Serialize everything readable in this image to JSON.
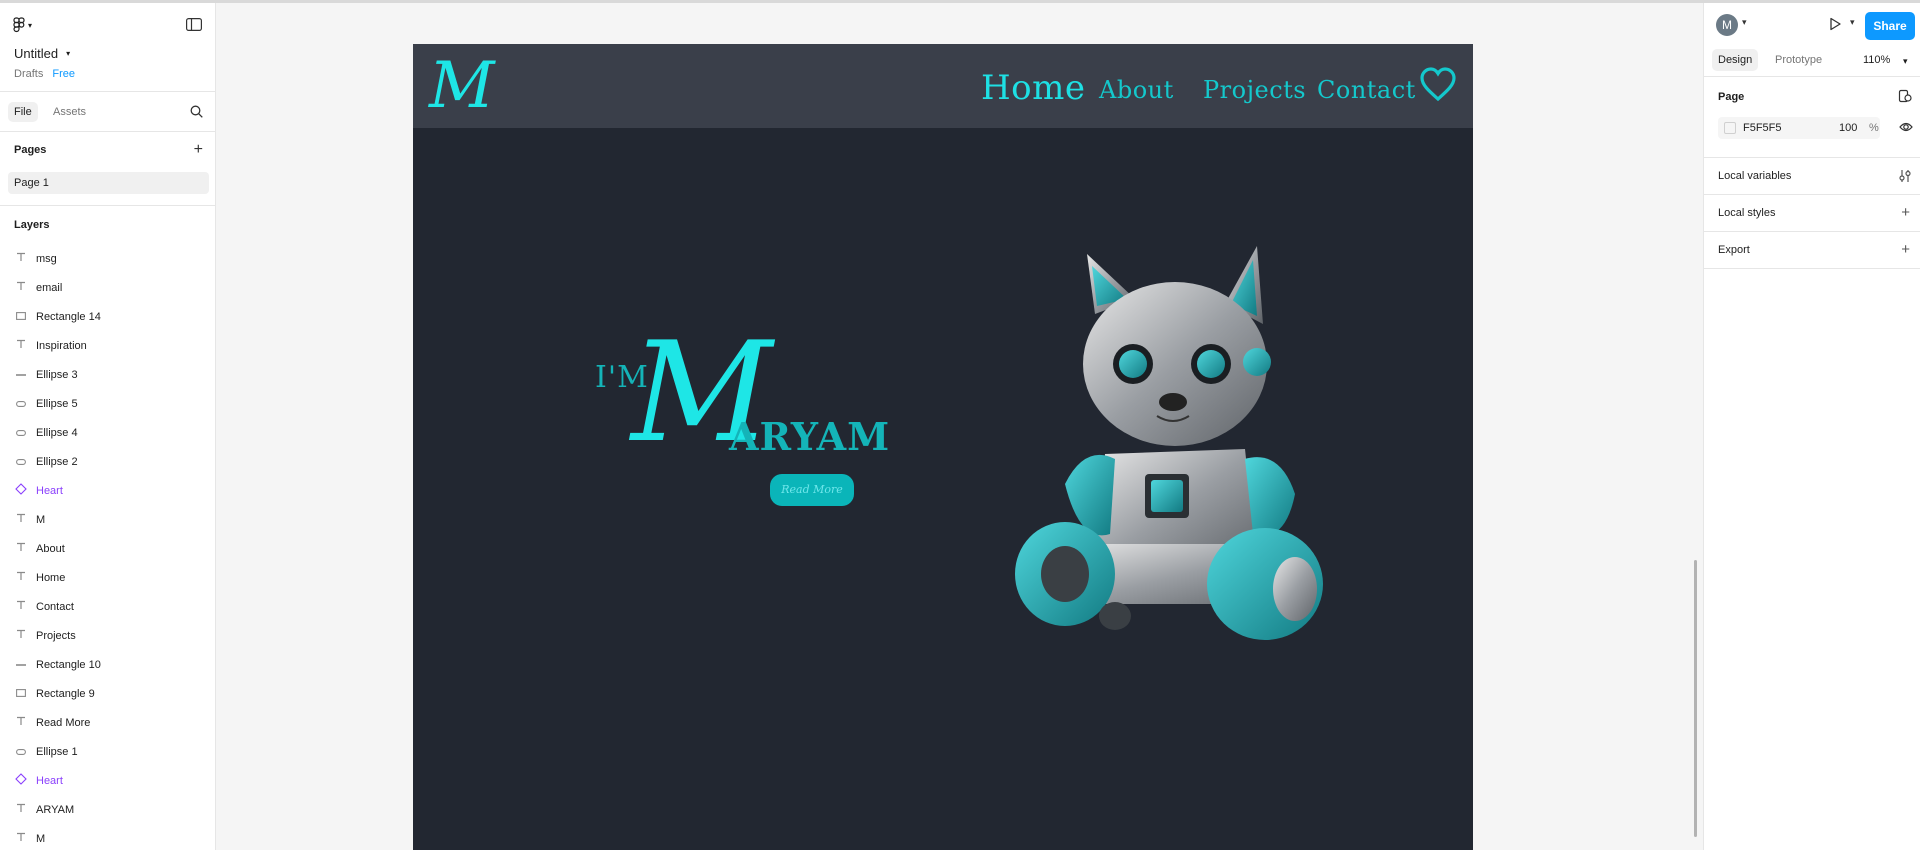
{
  "file": {
    "name": "Untitled",
    "location": "Drafts",
    "plan": "Free"
  },
  "left_tabs": {
    "file": "File",
    "assets": "Assets"
  },
  "pages": {
    "title": "Pages",
    "items": [
      "Page 1"
    ]
  },
  "layers": {
    "title": "Layers",
    "items": [
      {
        "name": "msg",
        "type": "text"
      },
      {
        "name": "email",
        "type": "text"
      },
      {
        "name": "Rectangle 14",
        "type": "rect"
      },
      {
        "name": "Inspiration",
        "type": "text"
      },
      {
        "name": "Ellipse 3",
        "type": "line"
      },
      {
        "name": "Ellipse 5",
        "type": "ellipse"
      },
      {
        "name": "Ellipse 4",
        "type": "ellipse"
      },
      {
        "name": "Ellipse 2",
        "type": "ellipse"
      },
      {
        "name": "Heart",
        "type": "component"
      },
      {
        "name": "M",
        "type": "text"
      },
      {
        "name": "About",
        "type": "text"
      },
      {
        "name": "Home",
        "type": "text"
      },
      {
        "name": "Contact",
        "type": "text"
      },
      {
        "name": "Projects",
        "type": "text"
      },
      {
        "name": "Rectangle 10",
        "type": "line"
      },
      {
        "name": "Rectangle 9",
        "type": "rect"
      },
      {
        "name": "Read More",
        "type": "text"
      },
      {
        "name": "Ellipse 1",
        "type": "ellipse"
      },
      {
        "name": "Heart",
        "type": "component"
      },
      {
        "name": "ARYAM",
        "type": "text"
      },
      {
        "name": "M",
        "type": "text"
      }
    ]
  },
  "design": {
    "logo": "M",
    "nav": {
      "home": "Home",
      "about": "About",
      "projects": "Projects",
      "contact": "Contact"
    },
    "hero": {
      "im": "I'M",
      "big_letter": "M",
      "rest": "ARYAM",
      "button": "Read More"
    }
  },
  "right": {
    "avatar": "M",
    "share": "Share",
    "tabs": {
      "design": "Design",
      "prototype": "Prototype"
    },
    "zoom": "110%",
    "page_section": {
      "title": "Page",
      "color": "F5F5F5",
      "opacity": "100",
      "unit": "%"
    },
    "sections": [
      "Local variables",
      "Local styles",
      "Export"
    ]
  },
  "colors": {
    "accent": "#0d99ff",
    "frame_bg": "#222731",
    "nav_bg": "#3a3f4a",
    "cyan": "#1ee6e6",
    "component": "#8a3ffc"
  }
}
